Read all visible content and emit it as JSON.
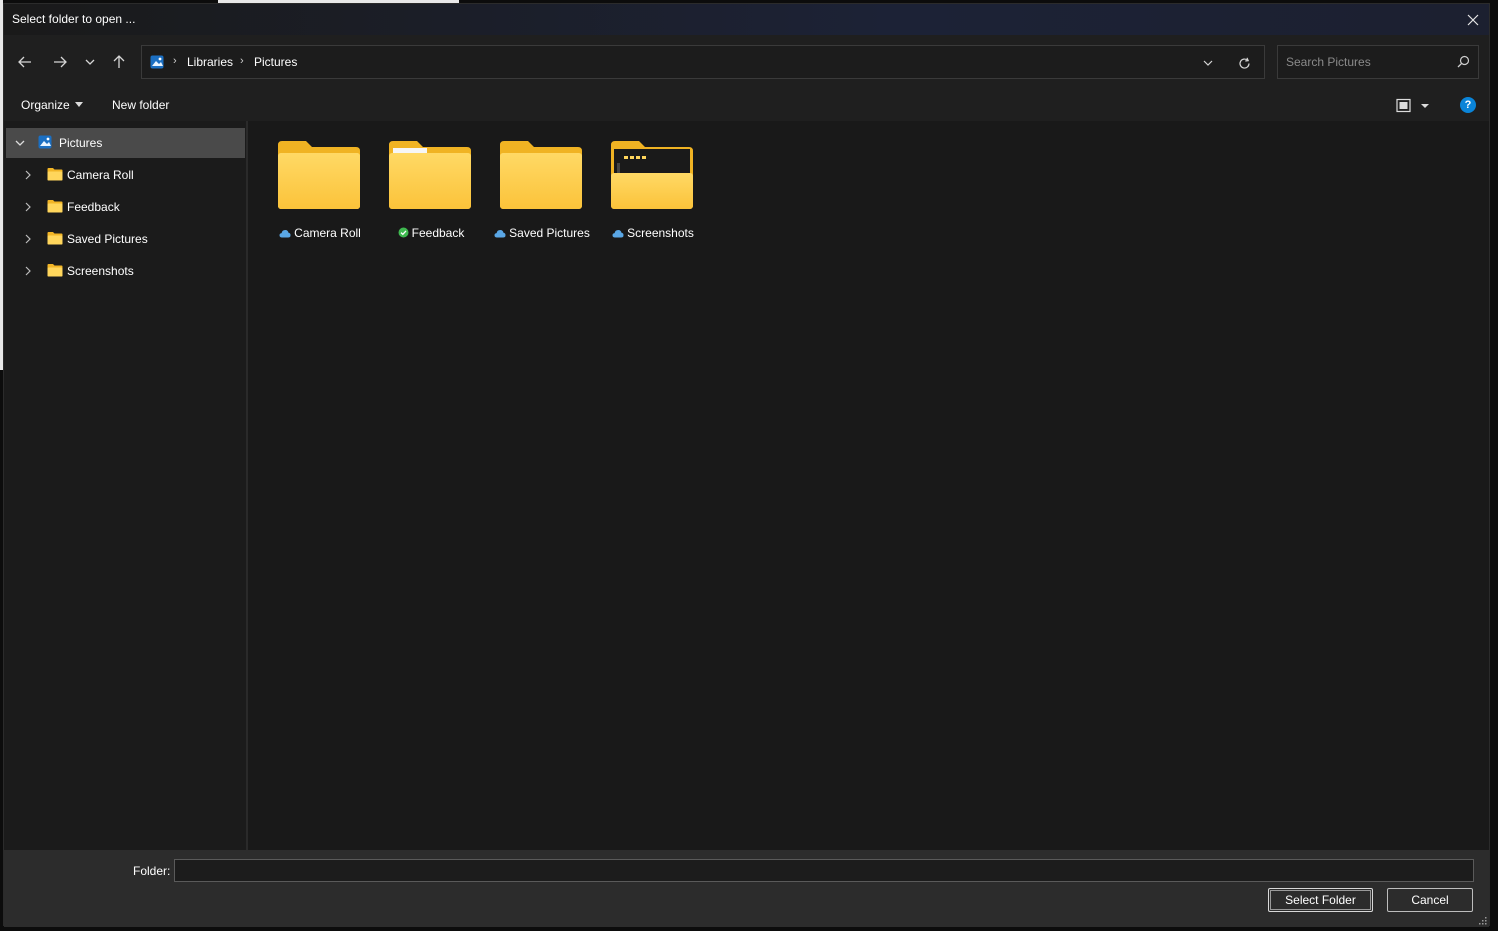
{
  "window": {
    "title": "Select folder to open ..."
  },
  "address": {
    "crumbs": [
      "Libraries",
      "Pictures"
    ],
    "location_icon": "pictures-library-icon"
  },
  "search": {
    "placeholder": "Search Pictures"
  },
  "commands": {
    "organize": "Organize",
    "new_folder": "New folder",
    "help": "?"
  },
  "navpane": {
    "items": [
      {
        "label": "Pictures",
        "icon": "pictures-library-icon",
        "expanded": true,
        "selected": true
      },
      {
        "label": "Camera Roll",
        "icon": "folder-icon"
      },
      {
        "label": "Feedback",
        "icon": "folder-icon"
      },
      {
        "label": "Saved Pictures",
        "icon": "folder-icon"
      },
      {
        "label": "Screenshots",
        "icon": "folder-icon"
      }
    ]
  },
  "content": {
    "folders": [
      {
        "label": "Camera Roll",
        "status": "cloud-icon"
      },
      {
        "label": "Feedback",
        "status": "synced-check-icon"
      },
      {
        "label": "Saved Pictures",
        "status": "cloud-icon"
      },
      {
        "label": "Screenshots",
        "status": "cloud-icon"
      }
    ]
  },
  "footer": {
    "folder_label": "Folder:",
    "folder_value": "",
    "select_button": "Select Folder",
    "cancel_button": "Cancel"
  },
  "colors": {
    "folder_yellow": "#f8c43a",
    "folder_light": "#ffd96a",
    "accent_blue": "#0a84d8",
    "cloud_blue": "#5aa7e6",
    "check_green": "#3fb950"
  }
}
